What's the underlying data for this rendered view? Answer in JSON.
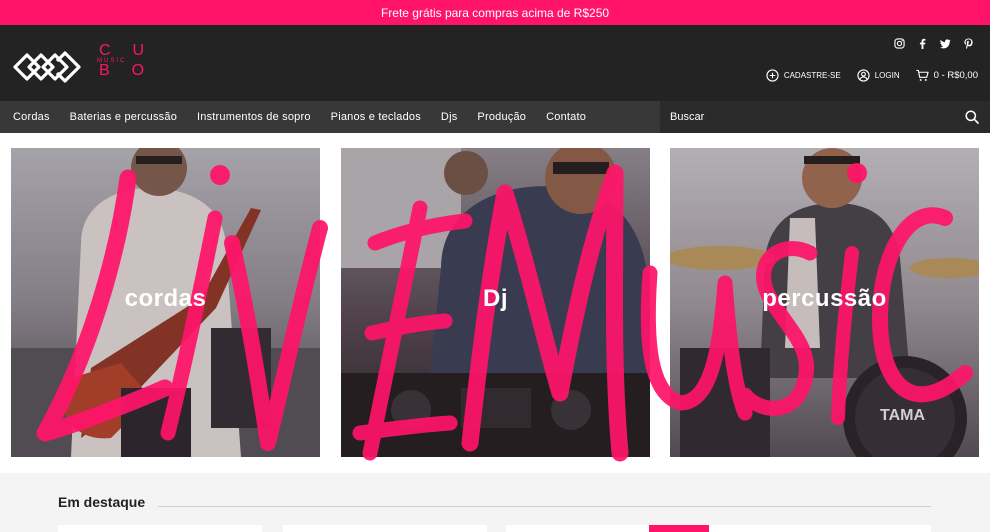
{
  "promo": {
    "text": "Frete grátis para compras acima de R$250"
  },
  "logo": {
    "line1": "CU",
    "line2": "MUSIC",
    "line3": "BO"
  },
  "social": [
    "instagram-icon",
    "facebook-icon",
    "twitter-icon",
    "pinterest-icon"
  ],
  "account": {
    "register_label": "CADASTRE-SE",
    "login_label": "LOGIN",
    "cart_label": "0 - R$0,00"
  },
  "nav": {
    "items": [
      "Cordas",
      "Baterias e percussão",
      "Instrumentos de sopro",
      "Pianos e teclados",
      "Djs",
      "Produção",
      "Contato"
    ]
  },
  "search": {
    "placeholder": "Buscar"
  },
  "hero": {
    "tiles": [
      {
        "label": "cordas"
      },
      {
        "label": "Dj"
      },
      {
        "label": "percussão"
      }
    ],
    "overlay_text": "LIVE MUSIC"
  },
  "featured": {
    "title": "Em destaque"
  },
  "colors": {
    "brand": "#ff1469",
    "header": "#232323",
    "nav": "#383838"
  }
}
